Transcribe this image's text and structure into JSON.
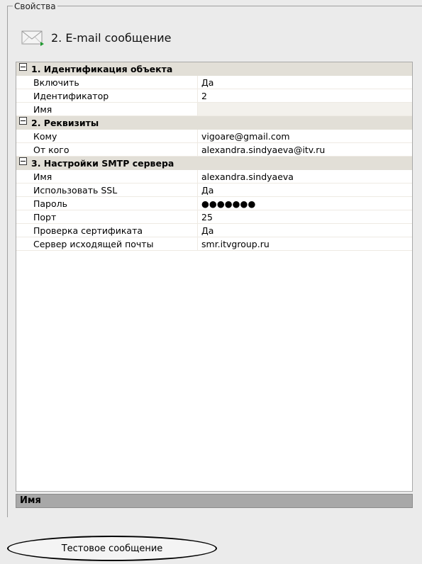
{
  "groupbox": {
    "legend": "Свойства"
  },
  "object": {
    "icon": "envelope-icon",
    "title": "2. E-mail сообщение"
  },
  "sections": [
    {
      "title": "1. Идентификация объекта",
      "rows": [
        {
          "name": "Включить",
          "value": "Да"
        },
        {
          "name": "Идентификатор",
          "value": "2"
        },
        {
          "name": "Имя",
          "value": ""
        }
      ]
    },
    {
      "title": "2. Реквизиты",
      "rows": [
        {
          "name": "Кому",
          "value": "vigoare@gmail.com"
        },
        {
          "name": "От кого",
          "value": "alexandra.sindyaeva@itv.ru"
        }
      ]
    },
    {
      "title": "3. Настройки SMTP сервера",
      "rows": [
        {
          "name": "Имя",
          "value": "alexandra.sindyaeva"
        },
        {
          "name": "Использовать SSL",
          "value": "Да"
        },
        {
          "name": "Пароль",
          "value": "●●●●●●●"
        },
        {
          "name": "Порт",
          "value": "25"
        },
        {
          "name": "Проверка сертификата",
          "value": "Да"
        },
        {
          "name": "Сервер исходящей почты",
          "value": "smr.itvgroup.ru"
        }
      ]
    }
  ],
  "description": {
    "label": "Имя"
  },
  "actions": {
    "test_button_label": "Тестовое сообщение"
  },
  "colors": {
    "section_bg": "#e2dfd7",
    "desc_bar_bg": "#a8a8a8",
    "window_bg": "#ebebeb"
  }
}
